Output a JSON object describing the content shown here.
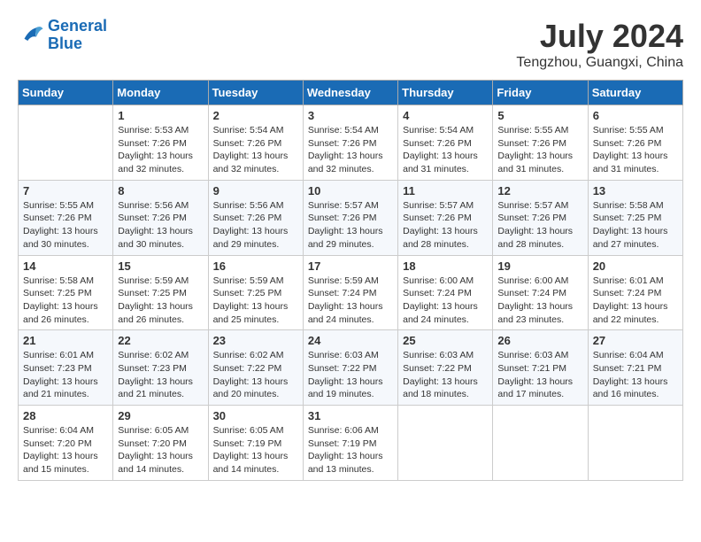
{
  "header": {
    "logo_line1": "General",
    "logo_line2": "Blue",
    "month_year": "July 2024",
    "location": "Tengzhou, Guangxi, China"
  },
  "weekdays": [
    "Sunday",
    "Monday",
    "Tuesday",
    "Wednesday",
    "Thursday",
    "Friday",
    "Saturday"
  ],
  "weeks": [
    [
      {
        "day": "",
        "sunrise": "",
        "sunset": "",
        "daylight": ""
      },
      {
        "day": "1",
        "sunrise": "Sunrise: 5:53 AM",
        "sunset": "Sunset: 7:26 PM",
        "daylight": "Daylight: 13 hours and 32 minutes."
      },
      {
        "day": "2",
        "sunrise": "Sunrise: 5:54 AM",
        "sunset": "Sunset: 7:26 PM",
        "daylight": "Daylight: 13 hours and 32 minutes."
      },
      {
        "day": "3",
        "sunrise": "Sunrise: 5:54 AM",
        "sunset": "Sunset: 7:26 PM",
        "daylight": "Daylight: 13 hours and 32 minutes."
      },
      {
        "day": "4",
        "sunrise": "Sunrise: 5:54 AM",
        "sunset": "Sunset: 7:26 PM",
        "daylight": "Daylight: 13 hours and 31 minutes."
      },
      {
        "day": "5",
        "sunrise": "Sunrise: 5:55 AM",
        "sunset": "Sunset: 7:26 PM",
        "daylight": "Daylight: 13 hours and 31 minutes."
      },
      {
        "day": "6",
        "sunrise": "Sunrise: 5:55 AM",
        "sunset": "Sunset: 7:26 PM",
        "daylight": "Daylight: 13 hours and 31 minutes."
      }
    ],
    [
      {
        "day": "7",
        "sunrise": "Sunrise: 5:55 AM",
        "sunset": "Sunset: 7:26 PM",
        "daylight": "Daylight: 13 hours and 30 minutes."
      },
      {
        "day": "8",
        "sunrise": "Sunrise: 5:56 AM",
        "sunset": "Sunset: 7:26 PM",
        "daylight": "Daylight: 13 hours and 30 minutes."
      },
      {
        "day": "9",
        "sunrise": "Sunrise: 5:56 AM",
        "sunset": "Sunset: 7:26 PM",
        "daylight": "Daylight: 13 hours and 29 minutes."
      },
      {
        "day": "10",
        "sunrise": "Sunrise: 5:57 AM",
        "sunset": "Sunset: 7:26 PM",
        "daylight": "Daylight: 13 hours and 29 minutes."
      },
      {
        "day": "11",
        "sunrise": "Sunrise: 5:57 AM",
        "sunset": "Sunset: 7:26 PM",
        "daylight": "Daylight: 13 hours and 28 minutes."
      },
      {
        "day": "12",
        "sunrise": "Sunrise: 5:57 AM",
        "sunset": "Sunset: 7:26 PM",
        "daylight": "Daylight: 13 hours and 28 minutes."
      },
      {
        "day": "13",
        "sunrise": "Sunrise: 5:58 AM",
        "sunset": "Sunset: 7:25 PM",
        "daylight": "Daylight: 13 hours and 27 minutes."
      }
    ],
    [
      {
        "day": "14",
        "sunrise": "Sunrise: 5:58 AM",
        "sunset": "Sunset: 7:25 PM",
        "daylight": "Daylight: 13 hours and 26 minutes."
      },
      {
        "day": "15",
        "sunrise": "Sunrise: 5:59 AM",
        "sunset": "Sunset: 7:25 PM",
        "daylight": "Daylight: 13 hours and 26 minutes."
      },
      {
        "day": "16",
        "sunrise": "Sunrise: 5:59 AM",
        "sunset": "Sunset: 7:25 PM",
        "daylight": "Daylight: 13 hours and 25 minutes."
      },
      {
        "day": "17",
        "sunrise": "Sunrise: 5:59 AM",
        "sunset": "Sunset: 7:24 PM",
        "daylight": "Daylight: 13 hours and 24 minutes."
      },
      {
        "day": "18",
        "sunrise": "Sunrise: 6:00 AM",
        "sunset": "Sunset: 7:24 PM",
        "daylight": "Daylight: 13 hours and 24 minutes."
      },
      {
        "day": "19",
        "sunrise": "Sunrise: 6:00 AM",
        "sunset": "Sunset: 7:24 PM",
        "daylight": "Daylight: 13 hours and 23 minutes."
      },
      {
        "day": "20",
        "sunrise": "Sunrise: 6:01 AM",
        "sunset": "Sunset: 7:24 PM",
        "daylight": "Daylight: 13 hours and 22 minutes."
      }
    ],
    [
      {
        "day": "21",
        "sunrise": "Sunrise: 6:01 AM",
        "sunset": "Sunset: 7:23 PM",
        "daylight": "Daylight: 13 hours and 21 minutes."
      },
      {
        "day": "22",
        "sunrise": "Sunrise: 6:02 AM",
        "sunset": "Sunset: 7:23 PM",
        "daylight": "Daylight: 13 hours and 21 minutes."
      },
      {
        "day": "23",
        "sunrise": "Sunrise: 6:02 AM",
        "sunset": "Sunset: 7:22 PM",
        "daylight": "Daylight: 13 hours and 20 minutes."
      },
      {
        "day": "24",
        "sunrise": "Sunrise: 6:03 AM",
        "sunset": "Sunset: 7:22 PM",
        "daylight": "Daylight: 13 hours and 19 minutes."
      },
      {
        "day": "25",
        "sunrise": "Sunrise: 6:03 AM",
        "sunset": "Sunset: 7:22 PM",
        "daylight": "Daylight: 13 hours and 18 minutes."
      },
      {
        "day": "26",
        "sunrise": "Sunrise: 6:03 AM",
        "sunset": "Sunset: 7:21 PM",
        "daylight": "Daylight: 13 hours and 17 minutes."
      },
      {
        "day": "27",
        "sunrise": "Sunrise: 6:04 AM",
        "sunset": "Sunset: 7:21 PM",
        "daylight": "Daylight: 13 hours and 16 minutes."
      }
    ],
    [
      {
        "day": "28",
        "sunrise": "Sunrise: 6:04 AM",
        "sunset": "Sunset: 7:20 PM",
        "daylight": "Daylight: 13 hours and 15 minutes."
      },
      {
        "day": "29",
        "sunrise": "Sunrise: 6:05 AM",
        "sunset": "Sunset: 7:20 PM",
        "daylight": "Daylight: 13 hours and 14 minutes."
      },
      {
        "day": "30",
        "sunrise": "Sunrise: 6:05 AM",
        "sunset": "Sunset: 7:19 PM",
        "daylight": "Daylight: 13 hours and 14 minutes."
      },
      {
        "day": "31",
        "sunrise": "Sunrise: 6:06 AM",
        "sunset": "Sunset: 7:19 PM",
        "daylight": "Daylight: 13 hours and 13 minutes."
      },
      {
        "day": "",
        "sunrise": "",
        "sunset": "",
        "daylight": ""
      },
      {
        "day": "",
        "sunrise": "",
        "sunset": "",
        "daylight": ""
      },
      {
        "day": "",
        "sunrise": "",
        "sunset": "",
        "daylight": ""
      }
    ]
  ]
}
